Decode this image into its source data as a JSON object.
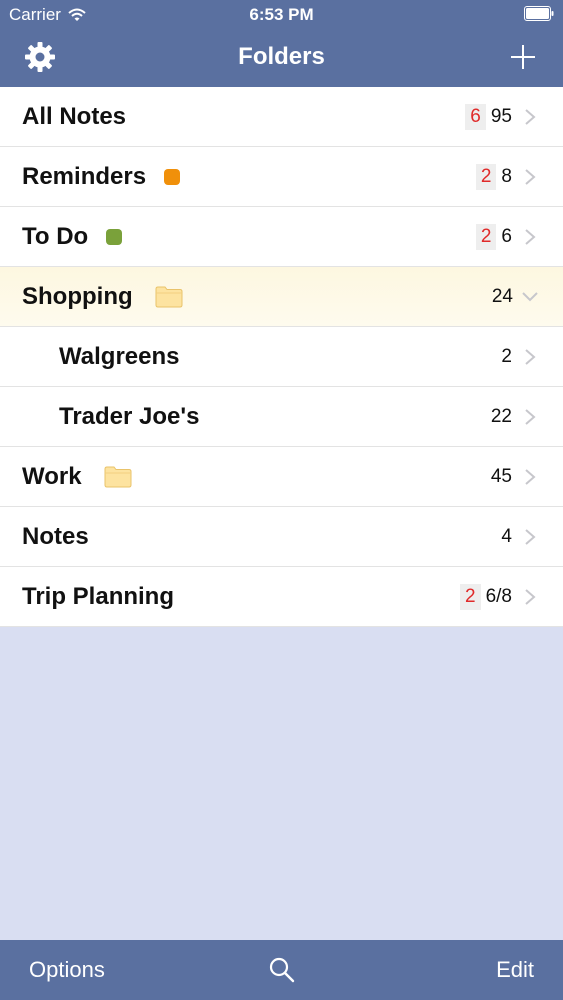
{
  "status_bar": {
    "carrier": "Carrier",
    "time": "6:53 PM",
    "icons": [
      "wifi-icon",
      "battery-icon"
    ]
  },
  "nav": {
    "title": "Folders",
    "left_icon": "gear-icon",
    "right_icon": "plus-icon"
  },
  "folders": [
    {
      "name": "All Notes",
      "badge": "6",
      "count": "95"
    },
    {
      "name": "Reminders",
      "tag_color": "#f0900a",
      "badge": "2",
      "count": "8"
    },
    {
      "name": "To Do",
      "tag_color": "#7aa13a",
      "badge": "2",
      "count": "6"
    },
    {
      "name": "Shopping",
      "icon": "folder-icon",
      "count": "24",
      "expanded": true
    },
    {
      "name": "Walgreens",
      "count": "2",
      "child": true
    },
    {
      "name": "Trader Joe's",
      "count": "22",
      "child": true
    },
    {
      "name": "Work",
      "icon": "folder-icon",
      "count": "45"
    },
    {
      "name": "Notes",
      "count": "4"
    },
    {
      "name": "Trip Planning",
      "badge": "2",
      "count": "6/8"
    }
  ],
  "toolbar": {
    "options_label": "Options",
    "search_icon": "search-icon",
    "edit_label": "Edit"
  },
  "colors": {
    "bar": "#5a70a0",
    "background": "#d9def2",
    "badge_text": "#e02a2a",
    "expanded_row": "#fdf7e0"
  }
}
